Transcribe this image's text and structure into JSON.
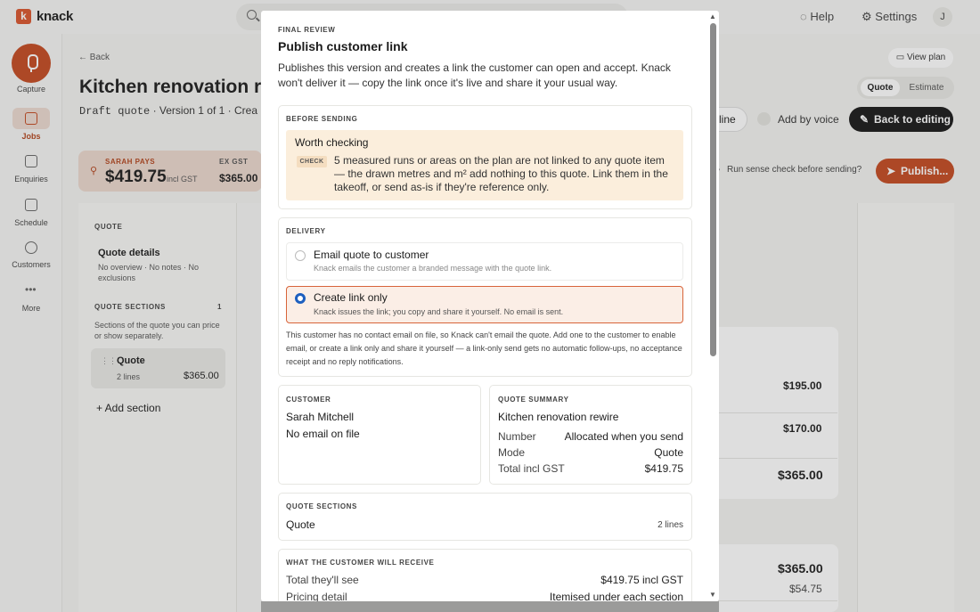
{
  "topbar": {
    "logo_letter": "k",
    "app_name": "knack",
    "help_label": "Help",
    "settings_label": "Settings",
    "avatar_initial": "J"
  },
  "sidebar": {
    "capture_label": "Capture",
    "items": [
      {
        "label": "Jobs",
        "icon": "briefcase-icon",
        "active": true
      },
      {
        "label": "Enquiries",
        "icon": "inbox-icon"
      },
      {
        "label": "Schedule",
        "icon": "calendar-icon"
      },
      {
        "label": "Customers",
        "icon": "people-icon"
      },
      {
        "label": "More",
        "icon": "dots-icon"
      }
    ]
  },
  "job": {
    "back_label": "← Back",
    "title": "Kitchen renovation rewire",
    "status": "Draft quote",
    "version": "Version 1 of 1",
    "created_prefix": "Crea",
    "view_plan": "View plan",
    "toggle": {
      "quote": "Quote",
      "estimate": "Estimate"
    },
    "add_line": "line",
    "add_by_voice": "Add by voice",
    "back_to_editing": "Back to editing",
    "pays_label": "SARAH PAYS",
    "pays_amount": "$419.75",
    "pays_gst": "incl GST",
    "ex_gst_label": "EX GST",
    "ex_gst_amount": "$365.00",
    "sense_check": "Run sense check before sending?",
    "publish": "Publish..."
  },
  "left_panel": {
    "quote_heading": "QUOTE",
    "details_title": "Quote details",
    "details_sub": "No overview · No notes · No exclusions",
    "sections_heading": "QUOTE SECTIONS",
    "sections_count": "1",
    "sections_desc": "Sections of the quote you can price or show separately.",
    "section_card": {
      "title": "Quote",
      "lines": "2 lines",
      "amount": "$365.00"
    },
    "add_section": "+ Add section"
  },
  "right_values": {
    "line1": "$195.00",
    "line2": "$170.00",
    "subtotal": "$365.00",
    "total": "$365.00",
    "gst": "$54.75"
  },
  "modal": {
    "eyebrow": "FINAL REVIEW",
    "title": "Publish customer link",
    "description": "Publishes this version and creates a link the customer can open and accept. Knack won't deliver it — copy the link once it's live and share it your usual way.",
    "before_sending": {
      "heading": "BEFORE SENDING",
      "warn_title": "Worth checking",
      "check_tag": "CHECK",
      "warn_text": "5 measured runs or areas on the plan are not linked to any quote item — the drawn metres and m² add nothing to this quote. Link them in the takeoff, or send as-is if they're reference only."
    },
    "delivery": {
      "heading": "DELIVERY",
      "options": [
        {
          "title": "Email quote to customer",
          "desc": "Knack emails the customer a branded message with the quote link.",
          "selected": false
        },
        {
          "title": "Create link only",
          "desc": "Knack issues the link; you copy and share it yourself. No email is sent.",
          "selected": true
        }
      ],
      "note": "This customer has no contact email on file, so Knack can't email the quote. Add one to the customer to enable email, or create a link only and share it yourself — a link-only send gets no automatic follow-ups, no acceptance receipt and no reply notifications."
    },
    "customer": {
      "heading": "CUSTOMER",
      "name": "Sarah Mitchell",
      "email_status": "No email on file"
    },
    "summary": {
      "heading": "QUOTE SUMMARY",
      "title": "Kitchen renovation rewire",
      "rows": [
        {
          "k": "Number",
          "v": "Allocated when you send"
        },
        {
          "k": "Mode",
          "v": "Quote"
        },
        {
          "k": "Total incl GST",
          "v": "$419.75"
        }
      ]
    },
    "sections": {
      "heading": "QUOTE SECTIONS",
      "name": "Quote",
      "lines": "2 lines"
    },
    "receive": {
      "heading": "WHAT THE CUSTOMER WILL RECEIVE",
      "rows": [
        {
          "k": "Total they'll see",
          "v": "$419.75 incl GST"
        },
        {
          "k": "Pricing detail",
          "v": "Itemised under each section"
        }
      ]
    }
  }
}
